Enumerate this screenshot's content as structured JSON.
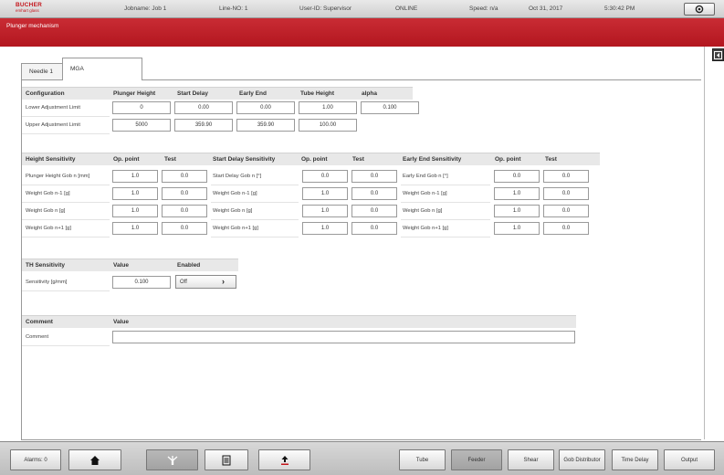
{
  "topbar": {
    "logo_line1": "BUCHER",
    "logo_line2": "emhart glass",
    "jobname": "Jobname: Job 1",
    "line_no": "Line-NO: 1",
    "user_id": "User-ID: Supervisor",
    "status": "ONLINE",
    "speed": "Speed: n/a",
    "date": "Oct 31, 2017",
    "time": "5:30:42 PM"
  },
  "titlebar": {
    "title": "Plunger mechanism"
  },
  "tabs": [
    {
      "label": "Needle 1"
    },
    {
      "label": "MGA"
    }
  ],
  "configuration": {
    "header": "Configuration",
    "columns": [
      "Plunger Height",
      "Start Delay",
      "Early End",
      "Tube Height",
      "alpha"
    ],
    "rows": [
      {
        "label": "Lower Adjustment Limit",
        "values": [
          "0",
          "0.00",
          "0.00",
          "1.00",
          "0.100"
        ]
      },
      {
        "label": "Upper Adjustment Limit",
        "values": [
          "5000",
          "359.90",
          "359.90",
          "100.00"
        ]
      }
    ]
  },
  "sensitivity": {
    "height": {
      "header": "Height Sensitivity",
      "col_op": "Op. point",
      "col_test": "Test",
      "rows": [
        {
          "label": "Plunger Height Gob n [mm]",
          "op": "1.0",
          "test": "0.0"
        },
        {
          "label": "Weight Gob n-1 [g]",
          "op": "1.0",
          "test": "0.0"
        },
        {
          "label": "Weight Gob n [g]",
          "op": "1.0",
          "test": "0.0"
        },
        {
          "label": "Weight Gob n+1 [g]",
          "op": "1.0",
          "test": "0.0"
        }
      ]
    },
    "start_delay": {
      "header": "Start Delay Sensitivity",
      "col_op": "Op. point",
      "col_test": "Test",
      "rows": [
        {
          "label": "Start Delay Gob n [°]",
          "op": "0.0",
          "test": "0.0"
        },
        {
          "label": "Weight Gob n-1 [g]",
          "op": "1.0",
          "test": "0.0"
        },
        {
          "label": "Weight Gob n [g]",
          "op": "1.0",
          "test": "0.0"
        },
        {
          "label": "Weight Gob n+1 [g]",
          "op": "1.0",
          "test": "0.0"
        }
      ]
    },
    "early_end": {
      "header": "Early End Sensitivity",
      "col_op": "Op. point",
      "col_test": "Test",
      "rows": [
        {
          "label": "Early End Gob n [°]",
          "op": "0.0",
          "test": "0.0"
        },
        {
          "label": "Weight Gob n-1 [g]",
          "op": "1.0",
          "test": "0.0"
        },
        {
          "label": "Weight Gob n [g]",
          "op": "1.0",
          "test": "0.0"
        },
        {
          "label": "Weight Gob n+1 [g]",
          "op": "1.0",
          "test": "0.0"
        }
      ]
    }
  },
  "th_sensitivity": {
    "header": "TH Sensitivity",
    "col_value": "Value",
    "col_enabled": "Enabled",
    "row_label": "Sensitivity [g/mm]",
    "value": "0.100",
    "enabled": "Off"
  },
  "comment": {
    "header": "Comment",
    "col_value": "Value",
    "row_label": "Comment",
    "value": ""
  },
  "bottombar": {
    "alarms": "Alarms: 0",
    "home_icon": "home-icon",
    "plunger_icon": "plunger-icon",
    "equalize_icon": "equalize-icon",
    "upload_icon": "upload-icon",
    "tube": "Tube",
    "feeder": "Feeder",
    "shear": "Shear",
    "gob_distributor": "Gob Distributor",
    "time_delay": "Time Delay",
    "output": "Output"
  },
  "colors": {
    "brand_red": "#b71c24",
    "active_button": "#a8a8a8"
  }
}
